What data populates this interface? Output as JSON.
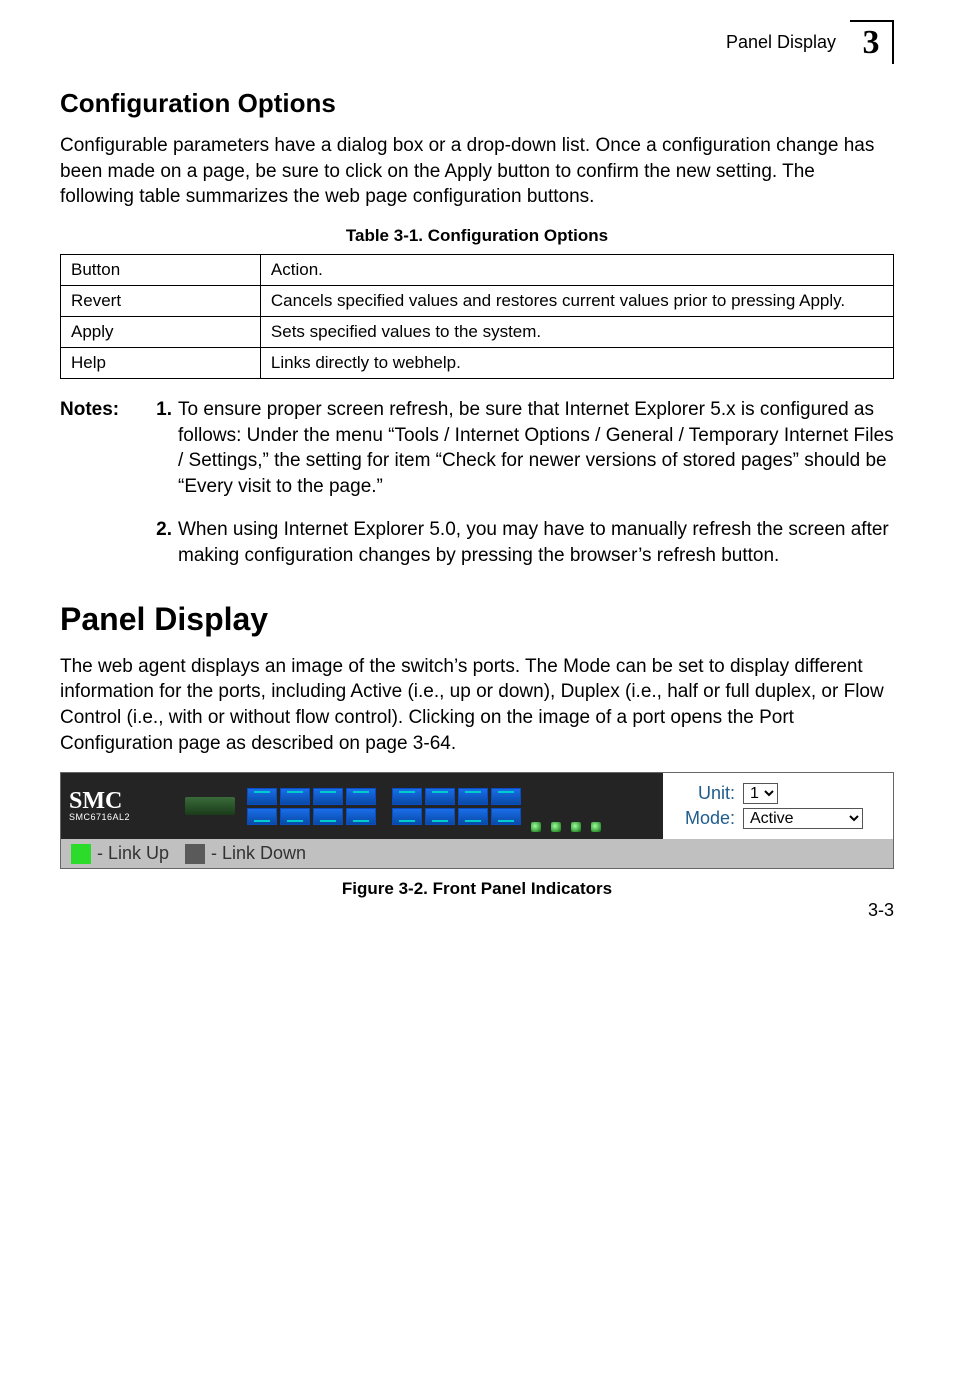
{
  "header": {
    "label": "Panel Display",
    "chapter": "3"
  },
  "section1": {
    "title": "Configuration Options",
    "intro": "Configurable parameters have a dialog box or a drop-down list. Once a configuration change has been made on a page, be sure to click on the Apply button to confirm the new setting. The following table summarizes the web page configuration buttons."
  },
  "table": {
    "caption": "Table 3-1.  Configuration Options",
    "rows": [
      {
        "c1": "Button",
        "c2": "Action."
      },
      {
        "c1": "Revert",
        "c2": "Cancels specified values and restores current values prior to pressing Apply."
      },
      {
        "c1": "Apply",
        "c2": "Sets specified values to the system."
      },
      {
        "c1": "Help",
        "c2": "Links directly to webhelp."
      }
    ]
  },
  "notes": {
    "label": "Notes:",
    "items": [
      {
        "n": "1.",
        "text": "To ensure proper screen refresh, be sure that Internet Explorer 5.x is configured as follows: Under the menu “Tools / Internet Options / General / Temporary Internet Files / Settings,” the setting for item “Check for newer versions of stored pages” should be “Every visit to the page.”"
      },
      {
        "n": "2.",
        "text": "When using Internet Explorer 5.0, you may have to manually refresh the screen after making configuration changes by pressing the browser’s refresh button."
      }
    ]
  },
  "section2": {
    "title": "Panel Display",
    "body": "The web agent displays an image of the switch’s ports. The Mode can be set to display different information for the ports, including Active (i.e., up or down), Duplex (i.e., half or full duplex, or Flow Control (i.e., with or without flow control). Clicking on the image of a port opens the Port Configuration page as described on page 3-64."
  },
  "panel": {
    "logo": "SMC",
    "model": "SMC6716AL2",
    "unit_label": "Unit:",
    "unit_value": "1",
    "mode_label": "Mode:",
    "mode_value": "Active",
    "legend_up": "- Link Up",
    "legend_down": "- Link Down"
  },
  "figure_caption": "Figure 3-2.  Front Panel Indicators",
  "page_number": "3-3"
}
